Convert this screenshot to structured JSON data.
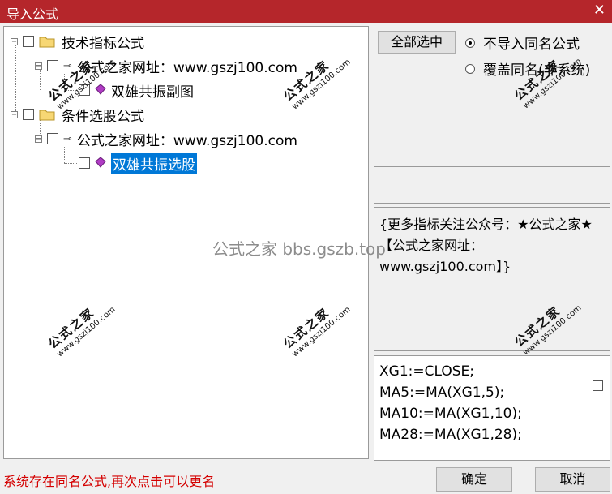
{
  "window": {
    "title": "导入公式",
    "close_glyph": "✕"
  },
  "tree": {
    "nodes": [
      {
        "label": "技术指标公式",
        "icon": "folder-icon",
        "expander": "−"
      },
      {
        "label": "公式之家网址：www.gszj100.com",
        "icon": "key-icon",
        "expander": "−"
      },
      {
        "label": "双雄共振副图",
        "icon": "formula-gem-icon"
      },
      {
        "label": "条件选股公式",
        "icon": "folder-icon",
        "expander": "−"
      },
      {
        "label": "公式之家网址：www.gszj100.com",
        "icon": "key-icon",
        "expander": "−"
      },
      {
        "label": "双雄共振选股",
        "icon": "formula-gem-icon",
        "selected": true
      }
    ]
  },
  "right": {
    "select_all_label": "全部选中",
    "radio_no_import_label": "不导入同名公式",
    "radio_overwrite_label": "覆盖同名(非系统)",
    "selected_radio": "不导入同名公式"
  },
  "description": "{更多指标关注公众号：★公式之家★ 【公式之家网址：www.gszj100.com】}",
  "code_lines": [
    "XG1:=CLOSE;",
    "MA5:=MA(XG1,5);",
    "MA10:=MA(XG1,10);",
    "MA28:=MA(XG1,28);"
  ],
  "status_text": "系统存在同名公式,再次点击可以更名",
  "buttons": {
    "ok": "确定",
    "cancel": "取消"
  },
  "watermarks": {
    "brand": "公式之家",
    "url": "www.gszj100.com",
    "center": "公式之家 bbs.gszb.top"
  },
  "colors": {
    "title_bar": "#b5262b",
    "selection": "#0078d7",
    "status_text": "#d40000"
  }
}
